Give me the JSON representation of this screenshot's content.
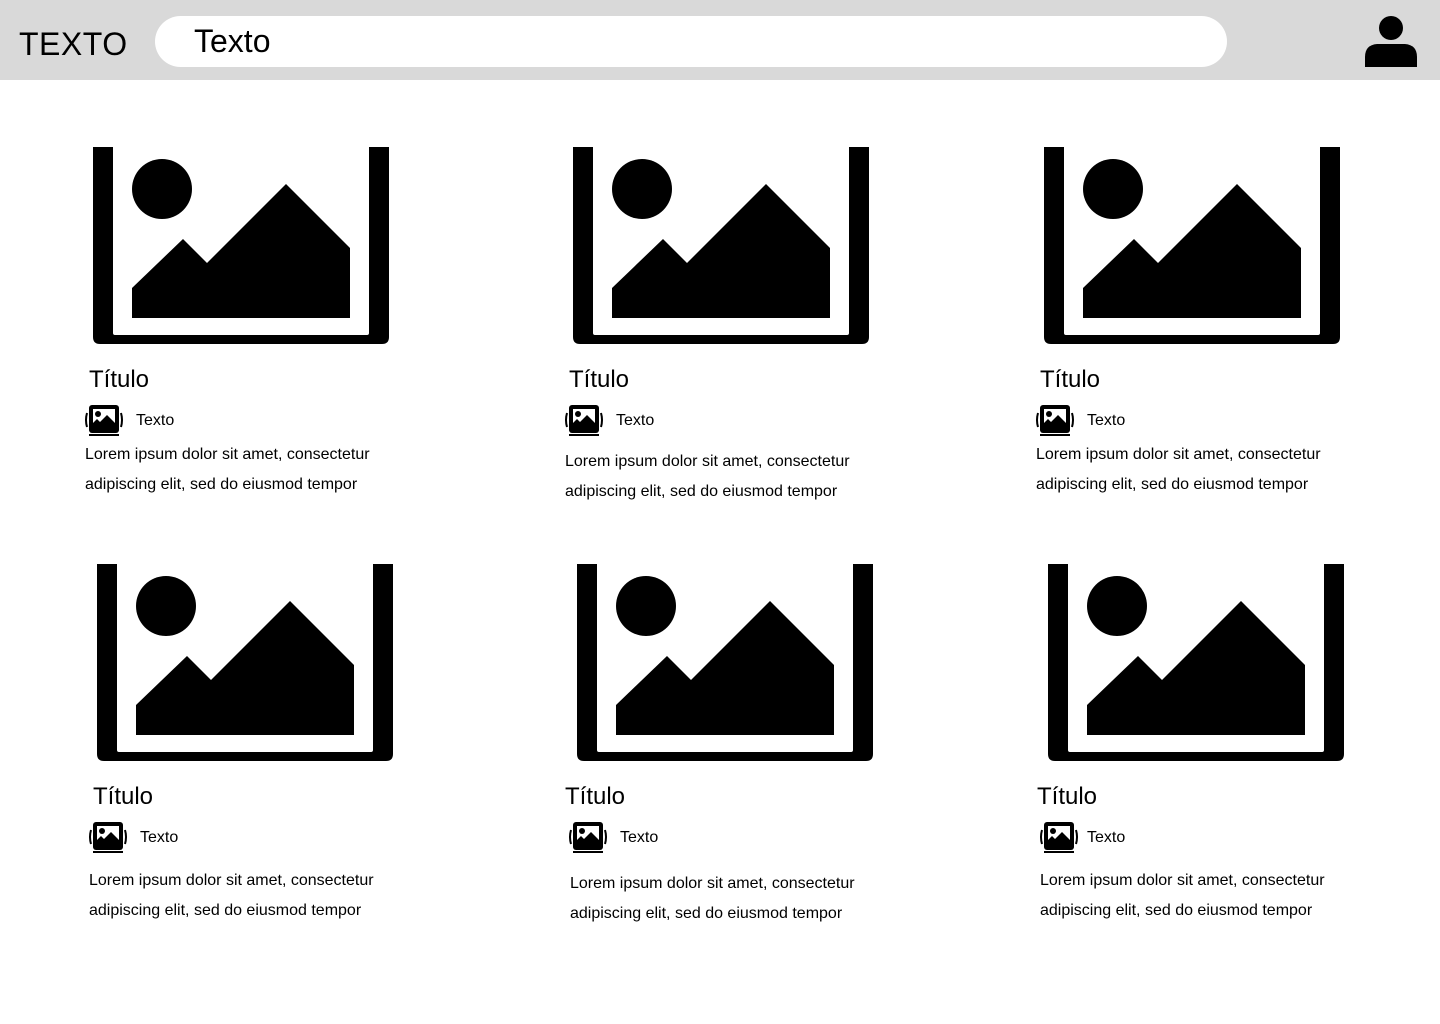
{
  "header": {
    "logo_text": "TEXTO",
    "search_value": "Texto",
    "user_icon": "user-icon"
  },
  "cards": [
    {
      "title": "Título",
      "author": "Texto",
      "description": "Lorem ipsum dolor sit amet, consectetur adipiscing elit, sed do eiusmod tempor"
    },
    {
      "title": "Título",
      "author": "Texto",
      "description": "Lorem ipsum dolor sit amet, consectetur adipiscing elit, sed do eiusmod tempor"
    },
    {
      "title": "Título",
      "author": "Texto",
      "description": "Lorem ipsum dolor sit amet, consectetur adipiscing elit, sed do eiusmod tempor"
    },
    {
      "title": "Título",
      "author": "Texto",
      "description": "Lorem ipsum dolor sit amet, consectetur adipiscing elit, sed do eiusmod tempor"
    },
    {
      "title": "Título",
      "author": "Texto",
      "description": "Lorem ipsum dolor sit amet, consectetur adipiscing elit, sed do eiusmod tempor"
    },
    {
      "title": "Título",
      "author": "Texto",
      "description": "Lorem ipsum dolor sit amet, consectetur adipiscing elit, sed do eiusmod tempor"
    }
  ],
  "colors": {
    "header_background": "#d9d9d9",
    "search_background": "#ffffff",
    "icon": "#000000"
  }
}
